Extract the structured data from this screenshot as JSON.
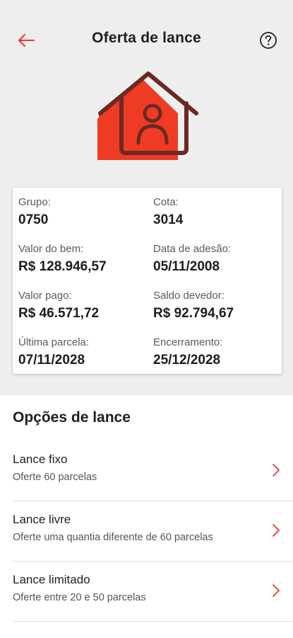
{
  "header": {
    "title": "Oferta de lance",
    "back_icon": "arrow-left-icon",
    "help_icon": "question-circle-icon"
  },
  "hero": {
    "icon": "house-person-icon"
  },
  "info": {
    "grupo_label": "Grupo:",
    "grupo_value": "0750",
    "cota_label": "Cota:",
    "cota_value": "3014",
    "valor_bem_label": "Valor do bem:",
    "valor_bem_value": "R$ 128.946,57",
    "data_adesao_label": "Data de adesão:",
    "data_adesao_value": "05/11/2008",
    "valor_pago_label": "Valor pago:",
    "valor_pago_value": "R$ 46.571,72",
    "saldo_devedor_label": "Saldo devedor:",
    "saldo_devedor_value": "R$ 92.794,67",
    "ultima_parcela_label": "Última parcela:",
    "ultima_parcela_value": "07/11/2028",
    "encerramento_label": "Encerramento:",
    "encerramento_value": "25/12/2028"
  },
  "options": {
    "title": "Opções de lance",
    "items": [
      {
        "title": "Lance fixo",
        "subtitle": "Oferte 60 parcelas"
      },
      {
        "title": "Lance livre",
        "subtitle": "Oferte uma quantia diferente de 60 parcelas"
      },
      {
        "title": "Lance limitado",
        "subtitle": "Oferte entre 20 e 50 parcelas"
      }
    ]
  },
  "colors": {
    "accent": "#e8382b",
    "accent_dark": "#6b2a22",
    "background": "#eeeeee"
  }
}
